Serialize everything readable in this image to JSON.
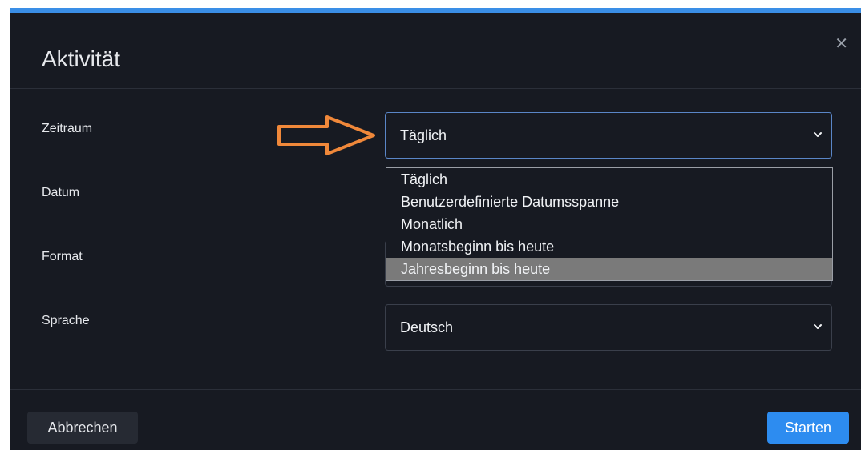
{
  "dialog": {
    "title": "Aktivität",
    "close_icon": "close-icon",
    "accent_color": "#3a8ee6"
  },
  "form": {
    "zeitraum": {
      "label": "Zeitraum",
      "value": "Täglich"
    },
    "datum": {
      "label": "Datum"
    },
    "format": {
      "label": "Format"
    },
    "sprache": {
      "label": "Sprache",
      "value": "Deutsch"
    }
  },
  "dropdown": {
    "options": [
      "Täglich",
      "Benutzerdefinierte Datumsspanne",
      "Monatlich",
      "Monatsbeginn bis heute",
      "Jahresbeginn bis heute"
    ],
    "highlighted": "Jahresbeginn bis heute"
  },
  "annotation": {
    "icon": "arrow-right-outline-icon",
    "color": "#f0883a"
  },
  "footer": {
    "cancel_label": "Abbrechen",
    "start_label": "Starten",
    "start_color": "#2d8cf0"
  }
}
